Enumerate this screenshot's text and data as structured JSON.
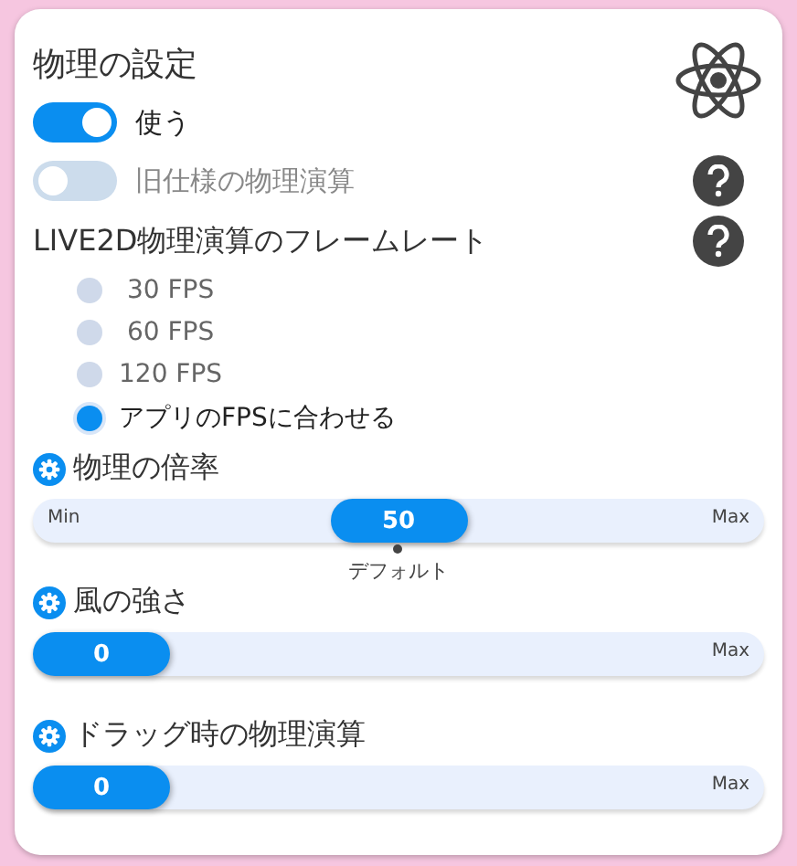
{
  "title": "物理の設定",
  "toggles": [
    {
      "label": "使う",
      "on": true,
      "disabled": false,
      "help": false
    },
    {
      "label": "旧仕様の物理演算",
      "on": false,
      "disabled": true,
      "help": true
    }
  ],
  "framerate": {
    "heading": "LIVE2D物理演算のフレームレート",
    "help": true,
    "options": [
      {
        "label": " 30 FPS",
        "selected": false
      },
      {
        "label": " 60 FPS",
        "selected": false
      },
      {
        "label": "120 FPS",
        "selected": false
      },
      {
        "label": "アプリのFPSに合わせる",
        "selected": true
      }
    ]
  },
  "sliders": [
    {
      "label": "物理の倍率",
      "value": "50",
      "level": 0.5,
      "min_label": "Min",
      "max_label": "Max",
      "default_label": "デフォルト"
    },
    {
      "label": "風の強さ",
      "value": "0",
      "level": 0,
      "max_label": "Max"
    },
    {
      "label": "ドラッグ時の物理演算",
      "value": "0",
      "level": 0,
      "max_label": "Max"
    }
  ]
}
